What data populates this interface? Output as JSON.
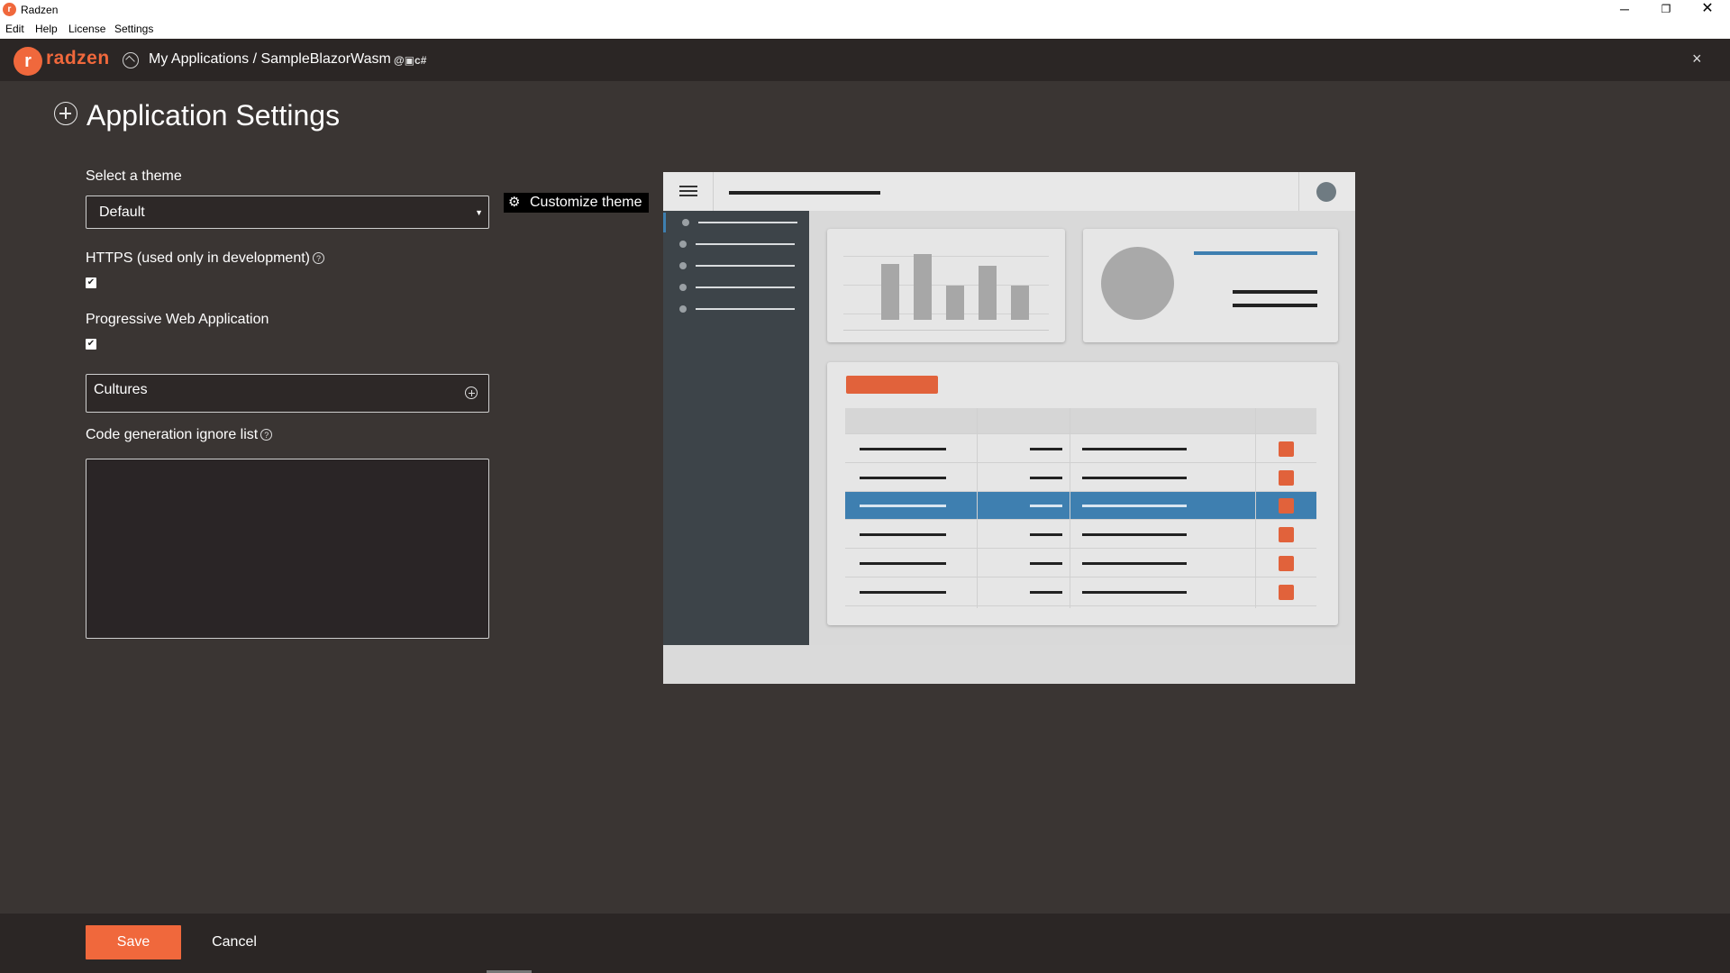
{
  "window": {
    "title": "Radzen",
    "controls": {
      "minimize": "─",
      "maximize": "❐",
      "close": "✕"
    }
  },
  "menu": {
    "items": [
      "Edit",
      "Help",
      "License",
      "Settings"
    ]
  },
  "header": {
    "logo_text": "radzen",
    "breadcrumb": "My Applications / SampleBlazorWasm",
    "tech_badges": "@▣c#",
    "close": "×"
  },
  "page": {
    "title": "Application Settings"
  },
  "form": {
    "theme_label": "Select a theme",
    "theme_value": "Default",
    "customize_label": "Customize theme",
    "https_label": "HTTPS (used only in development)",
    "https_checked": true,
    "pwa_label": "Progressive Web Application",
    "pwa_checked": true,
    "cultures_label": "Cultures",
    "ignore_label": "Code generation ignore list",
    "ignore_value": ""
  },
  "footer": {
    "save_label": "Save",
    "cancel_label": "Cancel"
  },
  "colors": {
    "accent": "#f0683c",
    "background": "#3a3533",
    "header": "#2b2625",
    "preview_highlight": "#3e7fb0"
  },
  "icons": {
    "app": "radzen-logo-icon",
    "home": "applications-icon",
    "title": "plus-circle-icon",
    "help": "help-icon",
    "gear": "gear-icon",
    "add": "add-circle-icon"
  }
}
